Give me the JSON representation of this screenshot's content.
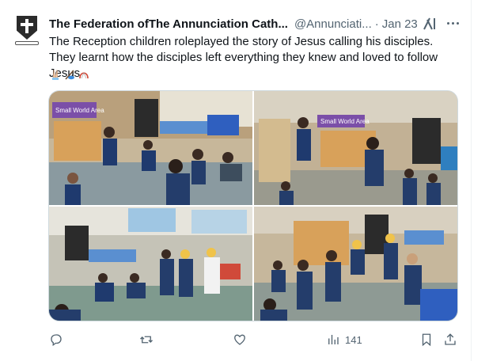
{
  "tweet": {
    "author_name": "The Federation ofThe Annunciation Cath...",
    "handle": "@Annunciati...",
    "separator": "·",
    "date": "Jan 23",
    "text": "The Reception children roleplayed the story of Jesus calling his disciples. They learnt how the disciples left everything they knew and loved to follow Jesus",
    "emoji": [
      "folded-hands-emoji",
      "fishing-pole-emoji",
      "net-emoji"
    ]
  },
  "media": {
    "photos": [
      {
        "name": "classroom-photo-1",
        "label": "Small World Area"
      },
      {
        "name": "classroom-photo-2",
        "label": "Small World Area"
      },
      {
        "name": "classroom-photo-3",
        "label": ""
      },
      {
        "name": "classroom-photo-4",
        "label": ""
      }
    ]
  },
  "actions": {
    "reply_icon": "reply-icon",
    "retweet_icon": "retweet-icon",
    "like_icon": "heart-icon",
    "views_icon": "views-icon",
    "views_count": "141",
    "bookmark_icon": "bookmark-icon",
    "share_icon": "share-icon"
  },
  "colors": {
    "text_primary": "#0f1419",
    "text_secondary": "#536471",
    "border": "#cfd9de"
  }
}
